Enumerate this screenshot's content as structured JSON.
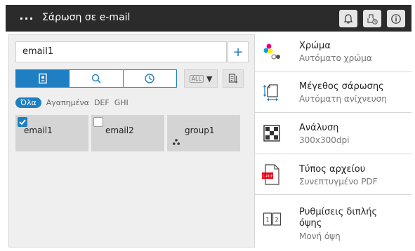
{
  "header": {
    "menu_label": "···",
    "title": "Σάρωση σε e-mail"
  },
  "address": {
    "value": "email1",
    "add_label": "+"
  },
  "search_tabs": [
    "address-book",
    "search",
    "history"
  ],
  "all_select": {
    "selected": "ALL",
    "arrow": "▼"
  },
  "filters": [
    "Όλα",
    "Αγαπημένα",
    "DEF",
    "GHI"
  ],
  "destinations": [
    {
      "label": "email1",
      "checked": true
    },
    {
      "label": "email2",
      "checked": false
    },
    {
      "label": "group1",
      "checked": false
    }
  ],
  "settings": [
    {
      "title": "Χρώμα",
      "value": "Αυτόματο χρώμα"
    },
    {
      "title": "Μέγεθος σάρωσης",
      "value": "Αυτόματη ανίχνευση"
    },
    {
      "title": "Ανάλυση",
      "value": "300x300dpi"
    },
    {
      "title": "Τύπος αρχείου",
      "value": "Συνεπτυγμένο PDF",
      "icon_text": "C-PDF"
    },
    {
      "title": "Ρυθμίσεις διπλής",
      "title2": "όψης",
      "value": "Μονή όψη"
    }
  ],
  "colors": {
    "accent": "#1e7fc2",
    "topbar": "#2b2b2b",
    "card": "#d4d4d4"
  }
}
